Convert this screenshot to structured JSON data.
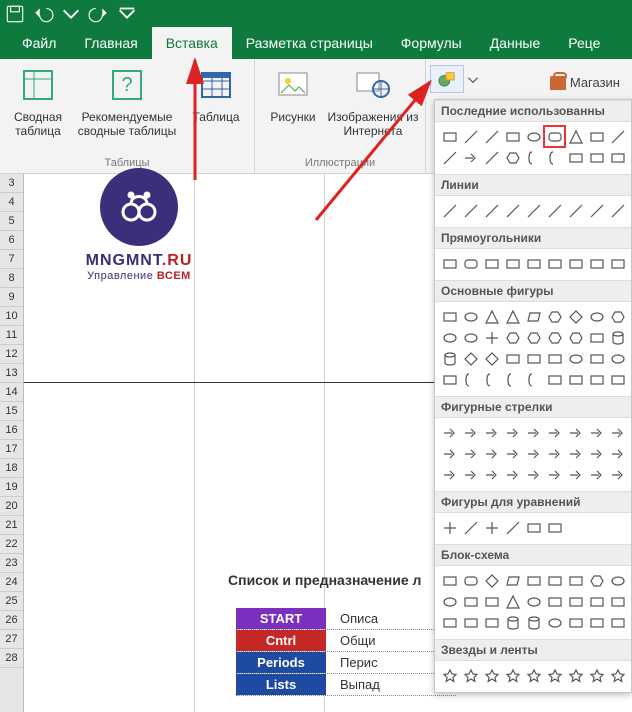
{
  "titlebar": {
    "save": "save-icon",
    "undo": "undo-icon",
    "redo": "redo-icon"
  },
  "tabs": {
    "file": "Файл",
    "home": "Главная",
    "insert": "Вставка",
    "pageLayout": "Разметка страницы",
    "formulas": "Формулы",
    "data": "Данные",
    "review": "Реце"
  },
  "ribbon": {
    "groups": {
      "tables": {
        "label": "Таблицы",
        "pivot": "Сводная таблица",
        "recommended": "Рекомендуемые сводные таблицы",
        "table": "Таблица"
      },
      "illustrations": {
        "label": "Иллюстрации",
        "pictures": "Рисунки",
        "onlinePictures": "Изображения из Интернета",
        "shapes": "Фигуры"
      }
    },
    "store": "Магазин"
  },
  "shapesDropdown": {
    "sections": {
      "recent": "Последние использованны",
      "lines": "Линии",
      "rectangles": "Прямоугольники",
      "basic": "Основные фигуры",
      "arrows": "Фигурные стрелки",
      "equation": "Фигуры для уравнений",
      "flowchart": "Блок-схема",
      "stars": "Звезды и ленты"
    }
  },
  "rowNumbers": [
    "3",
    "4",
    "5",
    "6",
    "7",
    "8",
    "9",
    "10",
    "11",
    "12",
    "13",
    "14",
    "15",
    "16",
    "17",
    "18",
    "19",
    "20",
    "21",
    "22",
    "23",
    "24",
    "25",
    "26",
    "27",
    "28"
  ],
  "logo": {
    "line1a": "MNGMNT",
    "line1b": ".RU",
    "line2a": "Управление ",
    "line2b": "ВСЕМ"
  },
  "content": {
    "title": "Список и предназначение л",
    "rows": [
      {
        "name": "START",
        "color": "#7a2fbf",
        "desc": "Описа"
      },
      {
        "name": "Cntrl",
        "color": "#c62828",
        "desc": "Общи"
      },
      {
        "name": "Periods",
        "color": "#1f4aa1",
        "desc": "Перис"
      },
      {
        "name": "Lists",
        "color": "#1f4aa1",
        "desc": "Выпад"
      }
    ]
  }
}
